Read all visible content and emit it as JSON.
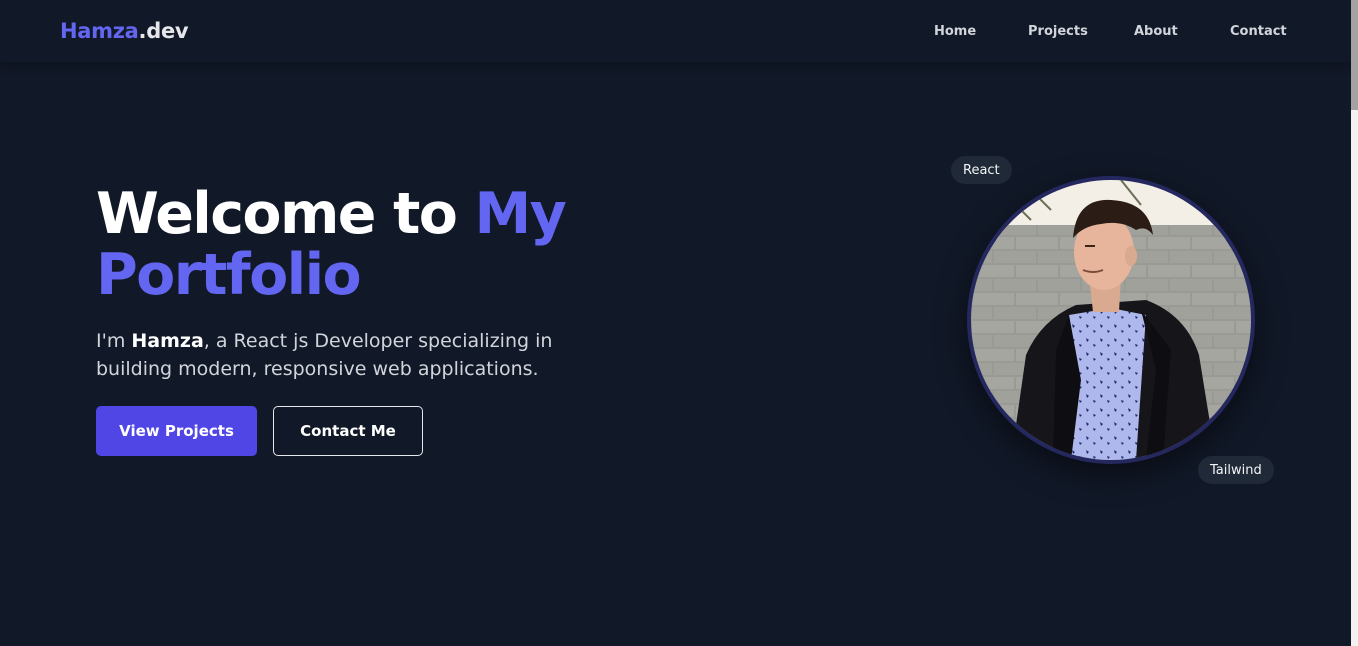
{
  "brand": {
    "name_accent": "Hamza",
    "name_rest": ".dev"
  },
  "nav": {
    "items": [
      {
        "label": "Home"
      },
      {
        "label": "Projects"
      },
      {
        "label": "About"
      },
      {
        "label": "Contact"
      }
    ]
  },
  "hero": {
    "title_part1": "Welcome to ",
    "title_part2": "My",
    "title_part3": "Portfolio",
    "desc_prefix": "I'm ",
    "desc_name": "Hamza",
    "desc_suffix": ", a React js Developer specializing in building modern, responsive web applications.",
    "primary_button": "View Projects",
    "secondary_button": "Contact Me"
  },
  "profile": {
    "badges": [
      "React",
      "Tailwind"
    ]
  },
  "colors": {
    "background": "#111827",
    "accent": "#6366f1",
    "primary_button": "#4f46e5",
    "badge_bg": "#1f2937"
  }
}
